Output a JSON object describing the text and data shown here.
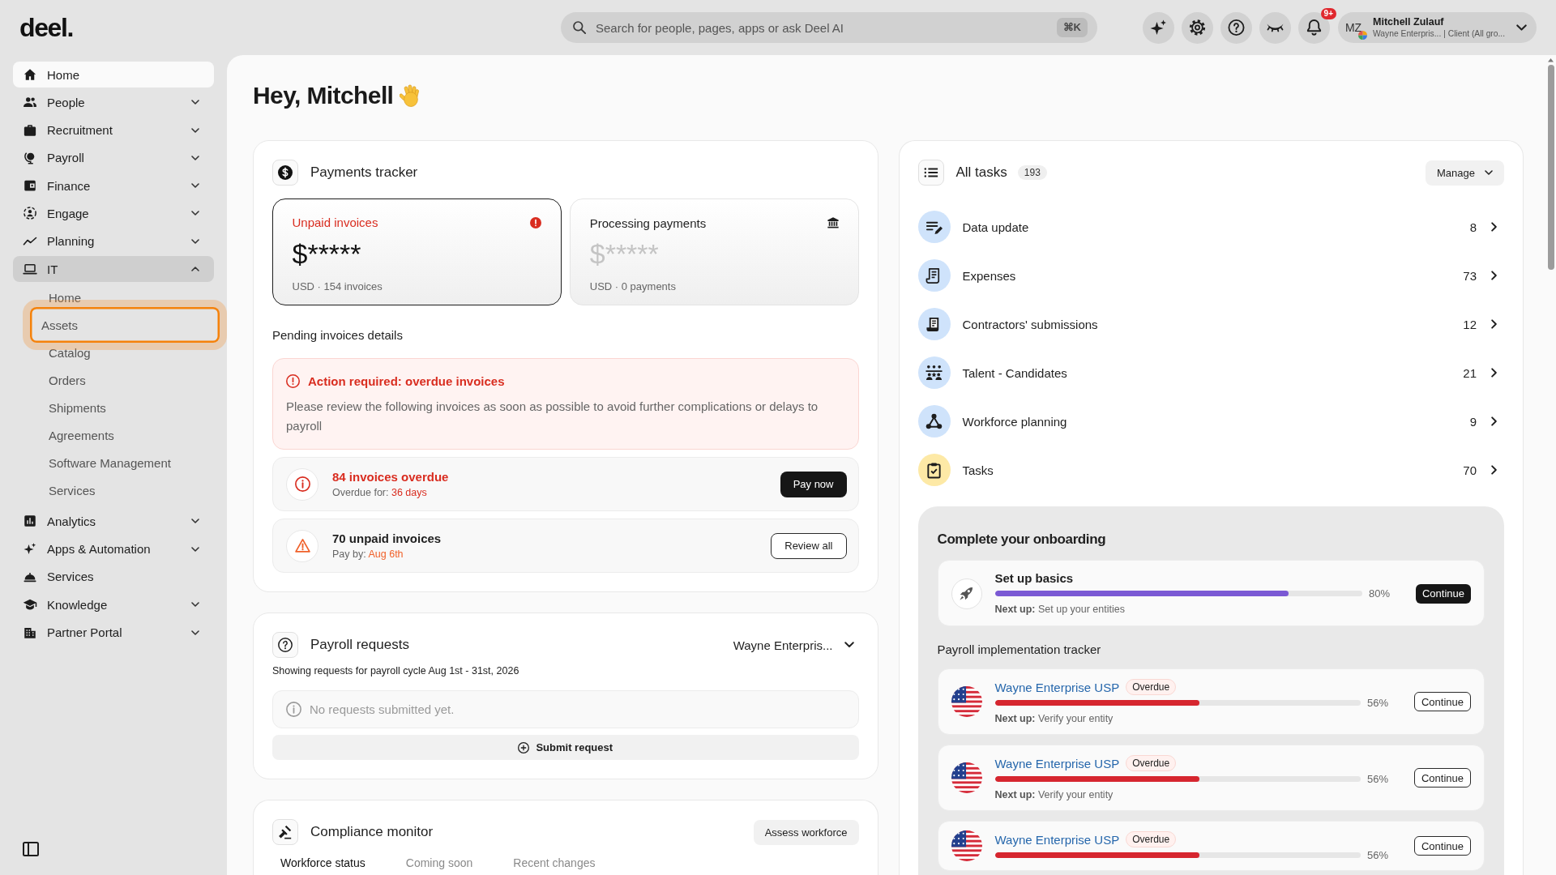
{
  "topbar": {
    "logo": "deel.",
    "search": {
      "placeholder": "Search for people, pages, apps or ask Deel AI",
      "shortcut": "⌘K"
    },
    "notification_badge": "9+",
    "profile": {
      "initials": "MZ",
      "name": "Mitchell Zulauf",
      "subtitle": "Wayne Enterpris... | Client (All gro..."
    }
  },
  "sidebar": {
    "items": [
      {
        "label": "Home",
        "expandable": false,
        "expanded": false,
        "selected": true
      },
      {
        "label": "People",
        "expandable": true,
        "expanded": false,
        "selected": false
      },
      {
        "label": "Recruitment",
        "expandable": true,
        "expanded": false,
        "selected": false
      },
      {
        "label": "Payroll",
        "expandable": true,
        "expanded": false,
        "selected": false
      },
      {
        "label": "Finance",
        "expandable": true,
        "expanded": false,
        "selected": false
      },
      {
        "label": "Engage",
        "expandable": true,
        "expanded": false,
        "selected": false
      },
      {
        "label": "Planning",
        "expandable": true,
        "expanded": false,
        "selected": false
      },
      {
        "label": "IT",
        "expandable": true,
        "expanded": true,
        "selected": false,
        "children": [
          {
            "label": "Home",
            "focused": false
          },
          {
            "label": "Assets",
            "focused": true
          },
          {
            "label": "Catalog",
            "focused": false
          },
          {
            "label": "Orders",
            "focused": false
          },
          {
            "label": "Shipments",
            "focused": false
          },
          {
            "label": "Agreements",
            "focused": false
          },
          {
            "label": "Software Management",
            "focused": false
          },
          {
            "label": "Services",
            "focused": false
          }
        ]
      },
      {
        "label": "Analytics",
        "expandable": true,
        "expanded": false,
        "selected": false
      },
      {
        "label": "Apps & Automation",
        "expandable": true,
        "expanded": false,
        "selected": false
      },
      {
        "label": "Services",
        "expandable": false,
        "expanded": false,
        "selected": false
      },
      {
        "label": "Knowledge",
        "expandable": true,
        "expanded": false,
        "selected": false
      },
      {
        "label": "Partner Portal",
        "expandable": true,
        "expanded": false,
        "selected": false
      }
    ]
  },
  "greeting": "Hey, Mitchell",
  "payments_tracker": {
    "title": "Payments tracker",
    "tiles": [
      {
        "kind": "alert",
        "label": "Unpaid invoices",
        "amount": "$*****",
        "meta": "USD · 154 invoices",
        "selected": true
      },
      {
        "kind": "bank",
        "label": "Processing payments",
        "amount": "$*****",
        "meta": "USD · 0 payments",
        "selected": false
      }
    ],
    "pending_title": "Pending invoices details",
    "alert": {
      "title": "Action required: overdue invoices",
      "body": "Please review the following invoices as soon as possible to avoid further complications or delays to payroll"
    },
    "rows": [
      {
        "kind": "overdue",
        "title": "84 invoices overdue",
        "detail_label": "Overdue for:",
        "detail_value": "36 days",
        "button": "Pay now"
      },
      {
        "kind": "unpaid",
        "title": "70 unpaid invoices",
        "detail_label": "Pay by:",
        "detail_value": "Aug 6th",
        "button": "Review all"
      }
    ]
  },
  "payroll_requests": {
    "title": "Payroll requests",
    "entity": "Wayne Enterpris...",
    "cycle": "Showing requests for payroll cycle Aug 1st - 31st, 2026",
    "empty_message": "No requests submitted yet.",
    "button": "Submit request"
  },
  "compliance_monitor": {
    "title": "Compliance monitor",
    "button": "Assess workforce",
    "tabs": [
      {
        "label": "Workforce status",
        "selected": true
      },
      {
        "label": "Coming soon",
        "selected": false
      },
      {
        "label": "Recent changes",
        "selected": false
      }
    ]
  },
  "all_tasks": {
    "title": "All tasks",
    "count": "193",
    "manage": "Manage",
    "items": [
      {
        "label": "Data update",
        "count": "8",
        "color": "#cfe3fb"
      },
      {
        "label": "Expenses",
        "count": "73",
        "color": "#cfe3fb"
      },
      {
        "label": "Contractors' submissions",
        "count": "12",
        "color": "#cfe3fb"
      },
      {
        "label": "Talent - Candidates",
        "count": "21",
        "color": "#cfe3fb"
      },
      {
        "label": "Workforce planning",
        "count": "9",
        "color": "#cfe3fb"
      },
      {
        "label": "Tasks",
        "count": "70",
        "color": "#fde9a6"
      }
    ],
    "onboarding": {
      "title": "Complete your onboarding",
      "setup": {
        "title": "Set up basics",
        "level": 0.8,
        "percent": "80%",
        "next": "**Next up:** Set up your entities",
        "button": "Continue"
      },
      "tracker_title": "Payroll implementation tracker",
      "trackers": [
        {
          "name": "Wayne Enterprise USP",
          "badge": "Overdue",
          "level": 0.56,
          "percent": "56%",
          "next": "**Next up:** Verify your entity",
          "button": "Continue"
        },
        {
          "name": "Wayne Enterprise USP",
          "badge": "Overdue",
          "level": 0.56,
          "percent": "56%",
          "next": "**Next up:** Verify your entity",
          "button": "Continue"
        },
        {
          "name": "Wayne Enterprise USP",
          "badge": "Overdue",
          "level": 0.56,
          "percent": "56%",
          "button": "Continue"
        }
      ]
    }
  }
}
